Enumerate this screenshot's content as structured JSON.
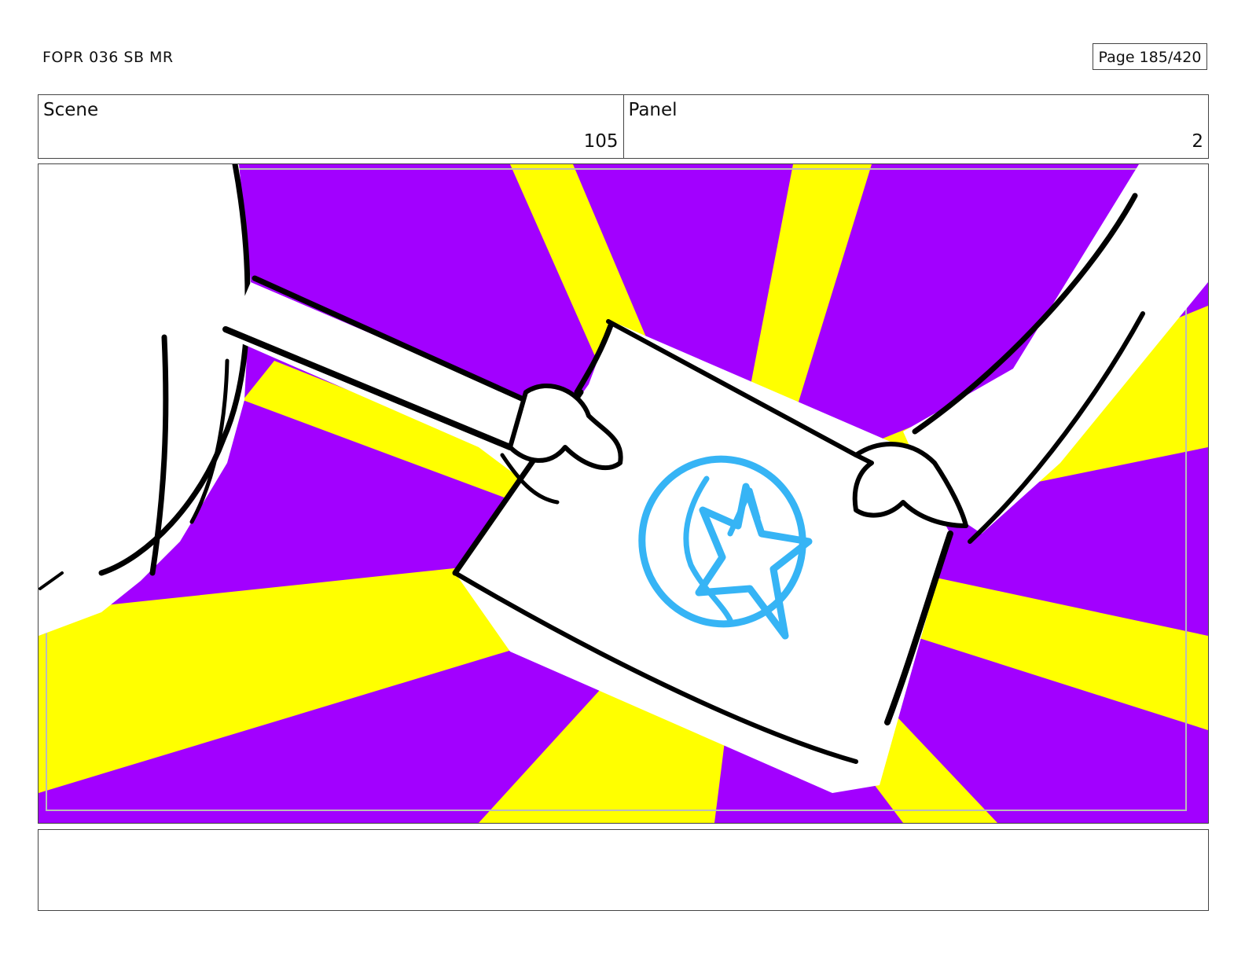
{
  "header": {
    "doc_title": "FOPR 036 SB MR",
    "page_counter": "Page 185/420"
  },
  "meta": {
    "scene_label": "Scene",
    "scene_value": "105",
    "panel_label": "Panel",
    "panel_value": "2"
  },
  "panel": {
    "colors": {
      "purple": "#A200FF",
      "yellow": "#FFFF00",
      "white": "#FFFFFF",
      "ink": "#000000",
      "emblem": "#36B4F5"
    },
    "emblem_icon": "star-in-circle-icon"
  },
  "notes": {
    "text": ""
  }
}
